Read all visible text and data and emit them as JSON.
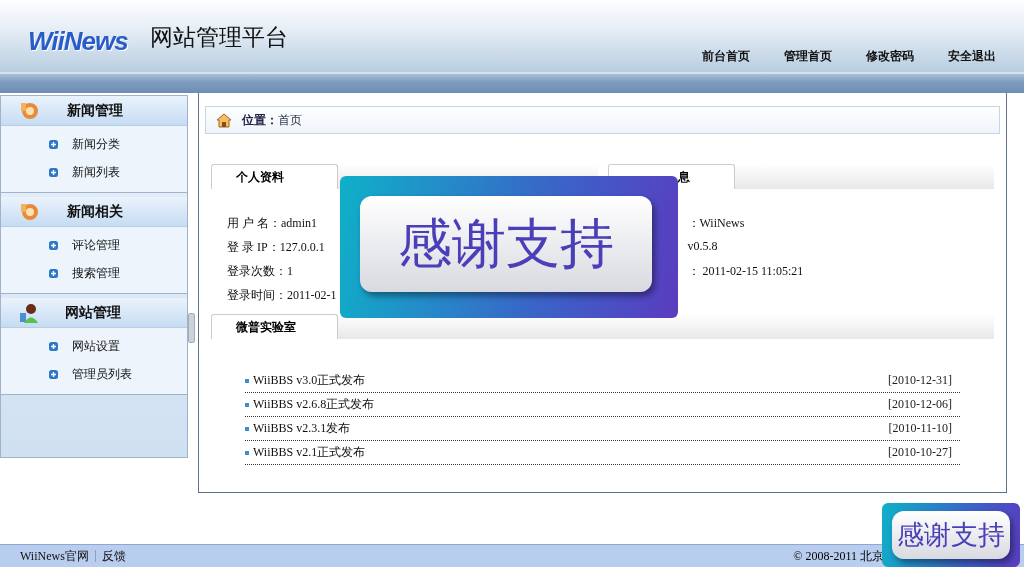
{
  "header": {
    "logo": "WiiNews",
    "title": "网站管理平台",
    "nav": [
      "前台首页",
      "管理首页",
      "修改密码",
      "安全退出"
    ]
  },
  "sidebar": {
    "groups": [
      {
        "title": "新闻管理",
        "kind": "gear",
        "items": [
          "新闻分类",
          "新闻列表"
        ]
      },
      {
        "title": "新闻相关",
        "kind": "gear",
        "items": [
          "评论管理",
          "搜索管理"
        ]
      },
      {
        "title": "网站管理",
        "kind": "user",
        "items": [
          "网站设置",
          "管理员列表"
        ]
      }
    ]
  },
  "breadcrumb": {
    "label": "位置：",
    "value": "首页"
  },
  "profile": {
    "tab": "个人资料",
    "rows": [
      {
        "label": "用 户 名：",
        "value": "admin1"
      },
      {
        "label": "登 录 IP：",
        "value": "127.0.0.1"
      },
      {
        "label": "登录次数：",
        "value": "1"
      },
      {
        "label": "登录时间：",
        "value": "2011-02-1"
      }
    ]
  },
  "system": {
    "tab": "息",
    "rows": [
      "：WiiNews",
      "v0.5.8",
      "：  2011-02-15 11:05:21"
    ]
  },
  "lab": {
    "tab": "微普实验室",
    "news": [
      {
        "title": "WiiBBS v3.0正式发布",
        "date": "[2010-12-31]"
      },
      {
        "title": "WiiBBS v2.6.8正式发布",
        "date": "[2010-12-06]"
      },
      {
        "title": "WiiBBS v2.3.1发布",
        "date": "[2010-11-10]"
      },
      {
        "title": "WiiBBS v2.1正式发布",
        "date": "[2010-10-27]"
      }
    ]
  },
  "footer": {
    "links": [
      "WiiNews官网",
      "反馈"
    ],
    "copyright": "© 2008-2011 北京"
  },
  "banners": [
    {
      "text": "感谢支持"
    },
    {
      "text": "感谢支持"
    }
  ]
}
